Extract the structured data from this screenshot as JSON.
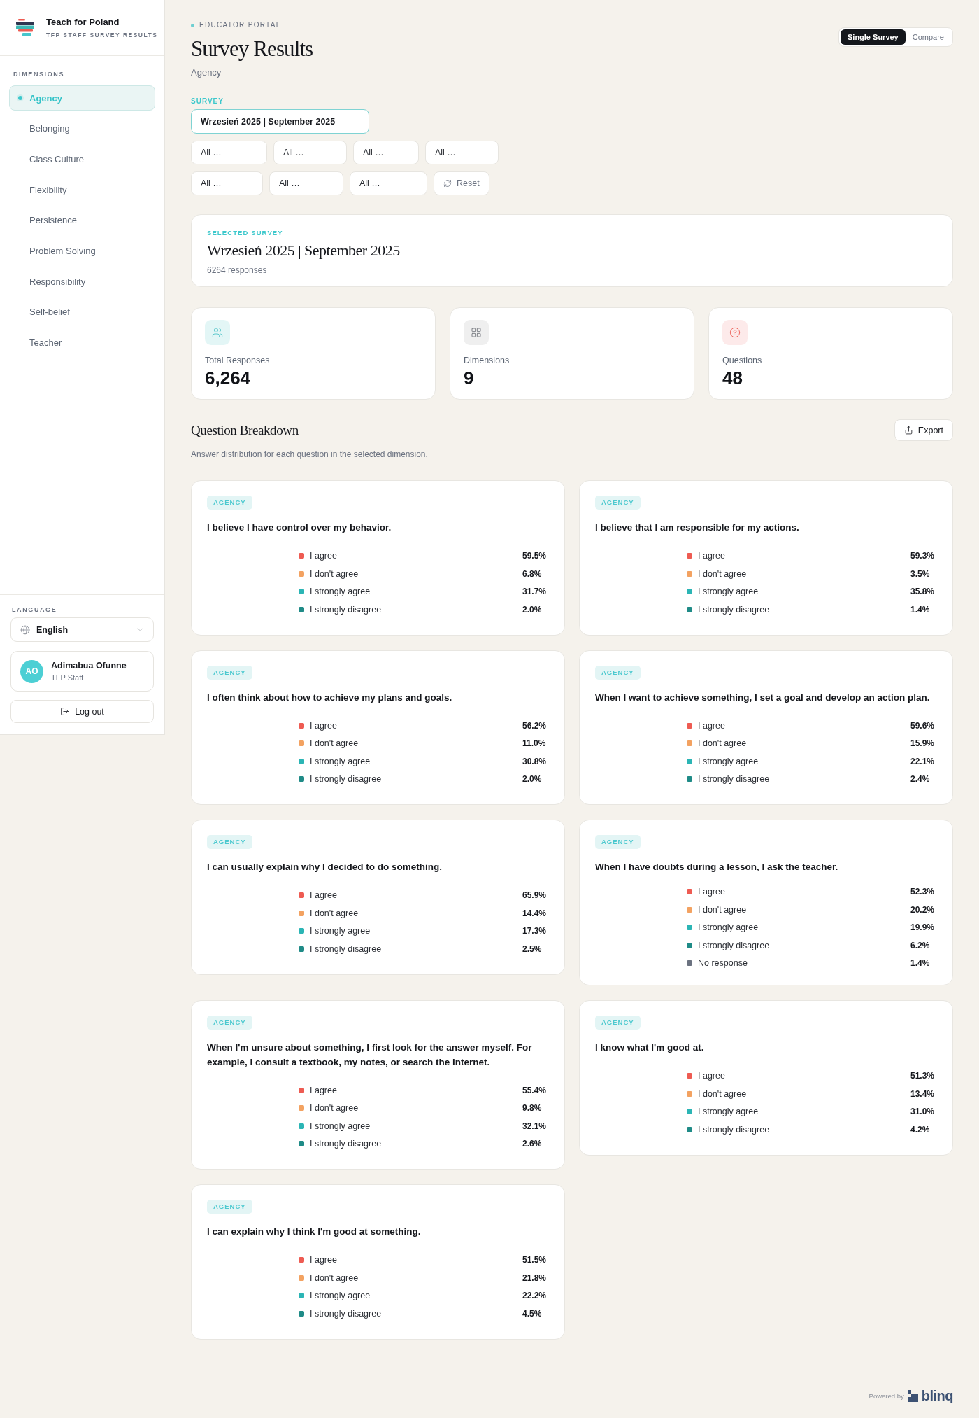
{
  "sidebar": {
    "brand": {
      "title": "Teach for Poland",
      "subtitle": "TFP STAFF SURVEY RESULTS"
    },
    "section_label": "DIMENSIONS",
    "items": [
      {
        "label": "Agency",
        "selected": true
      },
      {
        "label": "Belonging",
        "selected": false
      },
      {
        "label": "Class Culture",
        "selected": false
      },
      {
        "label": "Flexibility",
        "selected": false
      },
      {
        "label": "Persistence",
        "selected": false
      },
      {
        "label": "Problem Solving",
        "selected": false
      },
      {
        "label": "Responsibility",
        "selected": false
      },
      {
        "label": "Self-belief",
        "selected": false
      },
      {
        "label": "Teacher",
        "selected": false
      }
    ],
    "language": {
      "label": "LANGUAGE",
      "value": "English"
    },
    "user": {
      "initials": "AO",
      "name": "Adimabua Ofunne",
      "role": "TFP Staff"
    },
    "logout": "Log out"
  },
  "header": {
    "eyebrow": "EDUCATOR PORTAL",
    "title": "Survey Results",
    "subtitle": "Agency",
    "view_toggle": [
      {
        "label": "Single Survey",
        "selected": true
      },
      {
        "label": "Compare",
        "selected": false
      }
    ]
  },
  "filters": {
    "survey_label": "SURVEY",
    "survey_value": "Wrzesień 2025 | September 2025",
    "selects": [
      [
        "All …",
        "All …",
        "All …",
        "All …"
      ],
      [
        "All …",
        "All …",
        "All …"
      ]
    ],
    "reset": "Reset"
  },
  "selected_survey": {
    "label": "SELECTED SURVEY",
    "title": "Wrzesień 2025 | September 2025",
    "responses": "6264 responses"
  },
  "stats": [
    {
      "kind": "responses",
      "label": "Total Responses",
      "value": "6,264"
    },
    {
      "kind": "dimensions",
      "label": "Dimensions",
      "value": "9"
    },
    {
      "kind": "questions",
      "label": "Questions",
      "value": "48"
    }
  ],
  "breakdown": {
    "title": "Question Breakdown",
    "export": "Export",
    "subtitle": "Answer distribution for each question in the selected dimension.",
    "questions": [
      {
        "tag": "AGENCY",
        "text": "I believe I have control over my behavior.",
        "answers": [
          {
            "label": "I agree",
            "value": "59.5%",
            "color": "#ee5b52"
          },
          {
            "label": "I don't agree",
            "value": "6.8%",
            "color": "#f3a261"
          },
          {
            "label": "I strongly agree",
            "value": "31.7%",
            "color": "#2bb5b5"
          },
          {
            "label": "I strongly disagree",
            "value": "2.0%",
            "color": "#1f8b87"
          }
        ]
      },
      {
        "tag": "AGENCY",
        "text": "I believe that I am responsible for my actions.",
        "answers": [
          {
            "label": "I agree",
            "value": "59.3%",
            "color": "#ee5b52"
          },
          {
            "label": "I don't agree",
            "value": "3.5%",
            "color": "#f3a261"
          },
          {
            "label": "I strongly agree",
            "value": "35.8%",
            "color": "#2bb5b5"
          },
          {
            "label": "I strongly disagree",
            "value": "1.4%",
            "color": "#1f8b87"
          }
        ]
      },
      {
        "tag": "AGENCY",
        "text": "I often think about how to achieve my plans and goals.",
        "answers": [
          {
            "label": "I agree",
            "value": "56.2%",
            "color": "#ee5b52"
          },
          {
            "label": "I don't agree",
            "value": "11.0%",
            "color": "#f3a261"
          },
          {
            "label": "I strongly agree",
            "value": "30.8%",
            "color": "#2bb5b5"
          },
          {
            "label": "I strongly disagree",
            "value": "2.0%",
            "color": "#1f8b87"
          }
        ]
      },
      {
        "tag": "AGENCY",
        "text": "When I want to achieve something, I set a goal and develop an action plan.",
        "answers": [
          {
            "label": "I agree",
            "value": "59.6%",
            "color": "#ee5b52"
          },
          {
            "label": "I don't agree",
            "value": "15.9%",
            "color": "#f3a261"
          },
          {
            "label": "I strongly agree",
            "value": "22.1%",
            "color": "#2bb5b5"
          },
          {
            "label": "I strongly disagree",
            "value": "2.4%",
            "color": "#1f8b87"
          }
        ]
      },
      {
        "tag": "AGENCY",
        "text": "I can usually explain why I decided to do something.",
        "answers": [
          {
            "label": "I agree",
            "value": "65.9%",
            "color": "#ee5b52"
          },
          {
            "label": "I don't agree",
            "value": "14.4%",
            "color": "#f3a261"
          },
          {
            "label": "I strongly agree",
            "value": "17.3%",
            "color": "#2bb5b5"
          },
          {
            "label": "I strongly disagree",
            "value": "2.5%",
            "color": "#1f8b87"
          }
        ]
      },
      {
        "tag": "AGENCY",
        "text": "When I have doubts during a lesson, I ask the teacher.",
        "answers": [
          {
            "label": "I agree",
            "value": "52.3%",
            "color": "#ee5b52"
          },
          {
            "label": "I don't agree",
            "value": "20.2%",
            "color": "#f3a261"
          },
          {
            "label": "I strongly agree",
            "value": "19.9%",
            "color": "#2bb5b5"
          },
          {
            "label": "I strongly disagree",
            "value": "6.2%",
            "color": "#1f8b87"
          },
          {
            "label": "No response",
            "value": "1.4%",
            "color": "#6b7280"
          }
        ]
      },
      {
        "tag": "AGENCY",
        "text": "When I'm unsure about something, I first look for the answer myself. For example, I consult a textbook, my notes, or search the internet.",
        "answers": [
          {
            "label": "I agree",
            "value": "55.4%",
            "color": "#ee5b52"
          },
          {
            "label": "I don't agree",
            "value": "9.8%",
            "color": "#f3a261"
          },
          {
            "label": "I strongly agree",
            "value": "32.1%",
            "color": "#2bb5b5"
          },
          {
            "label": "I strongly disagree",
            "value": "2.6%",
            "color": "#1f8b87"
          }
        ]
      },
      {
        "tag": "AGENCY",
        "text": "I know what I'm good at.",
        "answers": [
          {
            "label": "I agree",
            "value": "51.3%",
            "color": "#ee5b52"
          },
          {
            "label": "I don't agree",
            "value": "13.4%",
            "color": "#f3a261"
          },
          {
            "label": "I strongly agree",
            "value": "31.0%",
            "color": "#2bb5b5"
          },
          {
            "label": "I strongly disagree",
            "value": "4.2%",
            "color": "#1f8b87"
          }
        ]
      },
      {
        "tag": "AGENCY",
        "text": "I can explain why I think I'm good at something.",
        "answers": [
          {
            "label": "I agree",
            "value": "51.5%",
            "color": "#ee5b52"
          },
          {
            "label": "I don't agree",
            "value": "21.8%",
            "color": "#f3a261"
          },
          {
            "label": "I strongly agree",
            "value": "22.2%",
            "color": "#2bb5b5"
          },
          {
            "label": "I strongly disagree",
            "value": "4.5%",
            "color": "#1f8b87"
          }
        ]
      }
    ]
  },
  "footer": {
    "label": "Powered by",
    "brand": "blinq"
  }
}
